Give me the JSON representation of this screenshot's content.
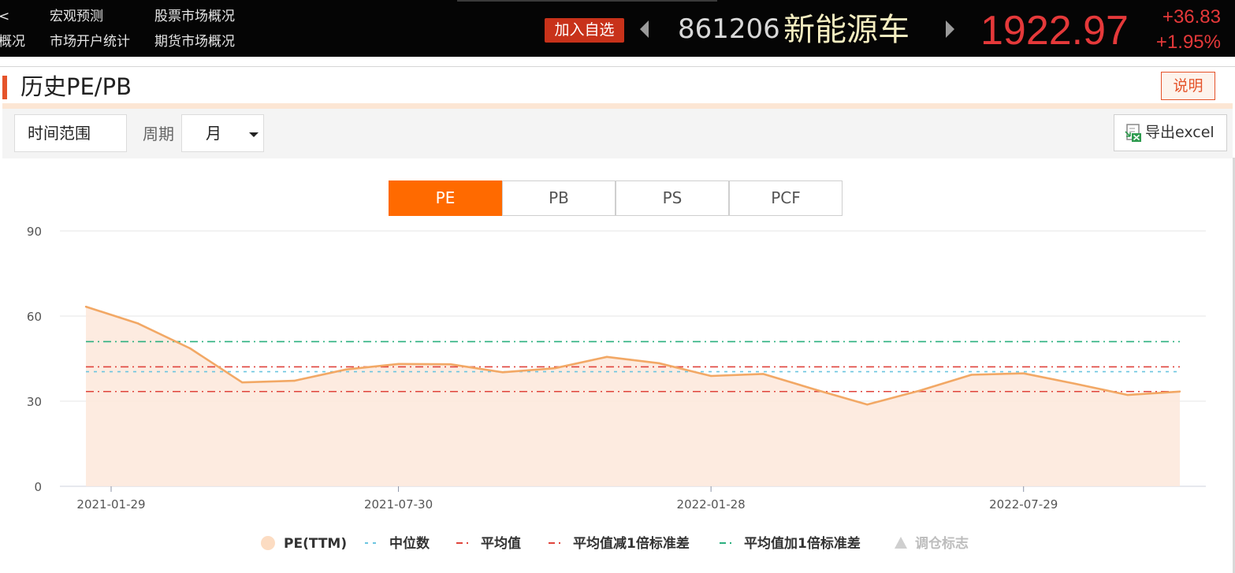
{
  "topbar": {
    "nav": [
      {
        "label": "宏观预测"
      },
      {
        "label": "股票市场概况"
      },
      {
        "label": "市场开户统计"
      },
      {
        "label": "期货市场概况"
      },
      {
        "label": "概况"
      },
      {
        "label": "<"
      }
    ],
    "add_favorite": "加入自选",
    "stock_code": "861206",
    "stock_name": "新能源车",
    "price": "1922.97",
    "change": "+36.83",
    "change_pct": "+1.95%"
  },
  "section": {
    "title": "历史PE/PB",
    "explain_button": "说明"
  },
  "toolbar": {
    "time_range": "时间范围",
    "period_label": "周期",
    "period_value": "月",
    "export_label": "导出excel"
  },
  "tabs": [
    {
      "label": "PE",
      "active": true
    },
    {
      "label": "PB",
      "active": false
    },
    {
      "label": "PS",
      "active": false
    },
    {
      "label": "PCF",
      "active": false
    }
  ],
  "colors": {
    "accent": "#ff6a00",
    "up": "#e5393a",
    "line": "#f2a865",
    "area": "#fde8da",
    "median": "#6cc5e0",
    "mean": "#e0443c",
    "plus_std": "#2bb07f"
  },
  "chart_data": {
    "type": "line",
    "x": [
      "2021-01-29",
      "2021-02-26",
      "2021-03-31",
      "2021-04-30",
      "2021-05-31",
      "2021-06-30",
      "2021-07-30",
      "2021-08-31",
      "2021-09-30",
      "2021-10-29",
      "2021-11-30",
      "2021-12-31",
      "2022-01-28",
      "2022-02-28",
      "2022-03-31",
      "2022-04-29",
      "2022-05-31",
      "2022-06-30",
      "2022-07-29",
      "2022-08-31",
      "2022-09-30",
      "2022-10-31"
    ],
    "x_ticks": [
      "2021-01-29",
      "2021-07-30",
      "2022-01-28",
      "2022-07-29"
    ],
    "series": [
      {
        "name": "PE(TTM)",
        "values": [
          63.3,
          57.4,
          48.6,
          36.6,
          37.2,
          41.2,
          43.1,
          43.0,
          40.2,
          41.6,
          45.6,
          43.4,
          38.9,
          39.6,
          34.1,
          28.8,
          33.7,
          39.3,
          39.8,
          36.1,
          32.2,
          33.4
        ]
      }
    ],
    "reference_lines": [
      {
        "name": "中位数",
        "value": 40.4
      },
      {
        "name": "平均值",
        "value": 42.1
      },
      {
        "name": "平均值减1倍标准差",
        "value": 33.4
      },
      {
        "name": "平均值加1倍标准差",
        "value": 51.0
      }
    ],
    "legend": [
      "PE(TTM)",
      "中位数",
      "平均值",
      "平均值减1倍标准差",
      "平均值加1倍标准差",
      "调仓标志"
    ],
    "y_ticks": [
      "0",
      "30",
      "60",
      "90"
    ],
    "ylim": [
      0,
      90
    ],
    "grid": true,
    "legend_position": "bottom"
  }
}
